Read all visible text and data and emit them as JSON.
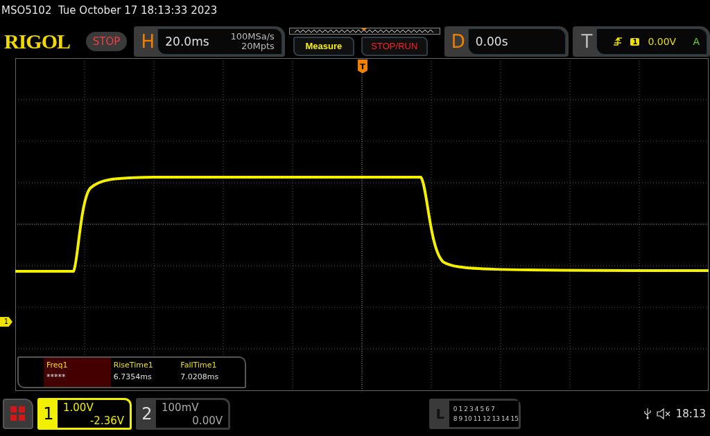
{
  "title_bar": {
    "text": "MSO5102  Tue October 17 18:13:33 2023"
  },
  "header": {
    "logo": "RIGOL",
    "run_state": "STOP",
    "horizontal": {
      "label": "H",
      "scale": "20.0ms",
      "sample_rate": "100MSa/s",
      "memory_depth": "20Mpts"
    },
    "buttons": [
      {
        "label": "Measure",
        "kind": "measure"
      },
      {
        "label": "STOP/RUN",
        "kind": "run"
      }
    ],
    "delay": {
      "label": "D",
      "value": "0.00s"
    },
    "trigger": {
      "label": "T",
      "source": "1",
      "level": "0.00V",
      "mode": "A"
    }
  },
  "display": {
    "trigger_marker": "T",
    "channel_marker": "1",
    "measurements": [
      {
        "name": "Freq1",
        "value": "*****",
        "selected": true
      },
      {
        "name": "RiseTime1",
        "value": "6.7354ms",
        "selected": false
      },
      {
        "name": "FallTime1",
        "value": "7.0208ms",
        "selected": false
      }
    ]
  },
  "channels": [
    {
      "number": "1",
      "scale": "1.00V",
      "offset": "-2.36V",
      "active": true
    },
    {
      "number": "2",
      "scale": "100mV",
      "offset": "0.00V",
      "active": false
    }
  ],
  "logic": {
    "label": "L",
    "row_1": [
      "0",
      "1",
      "2",
      "3",
      "4",
      "5",
      "6",
      "7"
    ],
    "row_2": [
      "8",
      "9",
      "10",
      "11",
      "12",
      "13",
      "14",
      "15"
    ]
  },
  "status": {
    "clock": "18:13"
  }
}
